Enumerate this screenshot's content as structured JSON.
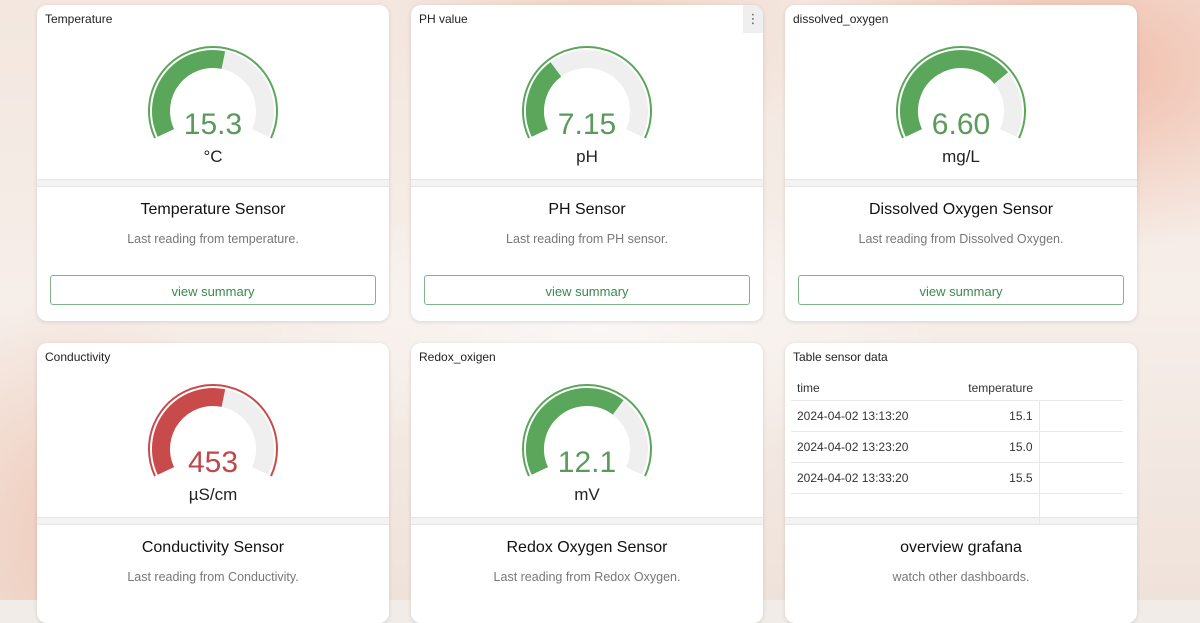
{
  "panels": [
    {
      "title": "Temperature",
      "value": "15.3",
      "unit": "°C",
      "level": 0.55,
      "color": "#5aa65a",
      "info_title": "Temperature Sensor",
      "info_sub": "Last reading from temperature.",
      "button": "view summary"
    },
    {
      "title": "PH value",
      "value": "7.15",
      "unit": "pH",
      "level": 0.34,
      "color": "#5aa65a",
      "info_title": "PH Sensor",
      "info_sub": "Last reading from PH sensor.",
      "button": "view summary",
      "menu_icon": "⋮"
    },
    {
      "title": "dissolved_oxygen",
      "value": "6.60",
      "unit": "mg/L",
      "level": 0.72,
      "color": "#5aa65a",
      "info_title": "Dissolved Oxygen Sensor",
      "info_sub": "Last reading from Dissolved Oxygen.",
      "button": "view summary"
    },
    {
      "title": "Conductivity",
      "value": "453",
      "unit": "µS/cm",
      "level": 0.55,
      "color": "#c94a4a",
      "info_title": "Conductivity Sensor",
      "info_sub": "Last reading from Conductivity."
    },
    {
      "title": "Redox_oxigen",
      "value": "12.1",
      "unit": "mV",
      "level": 0.66,
      "color": "#5aa65a",
      "info_title": "Redox Oxygen Sensor",
      "info_sub": "Last reading from Redox Oxygen."
    }
  ],
  "table_panel": {
    "title": "Table sensor data",
    "columns": [
      "time",
      "temperature"
    ],
    "rows": [
      [
        "2024-04-02 13:13:20",
        "15.1"
      ],
      [
        "2024-04-02 13:23:20",
        "15.0"
      ],
      [
        "2024-04-02 13:33:20",
        "15.5"
      ]
    ],
    "info_title": "overview grafana",
    "info_sub": "watch other dashboards."
  },
  "colors": {
    "ok": "#5aa65a",
    "alert": "#c94a4a",
    "track": "#efefef",
    "value_green": "#5b9a5b",
    "value_red": "#c0474a"
  }
}
